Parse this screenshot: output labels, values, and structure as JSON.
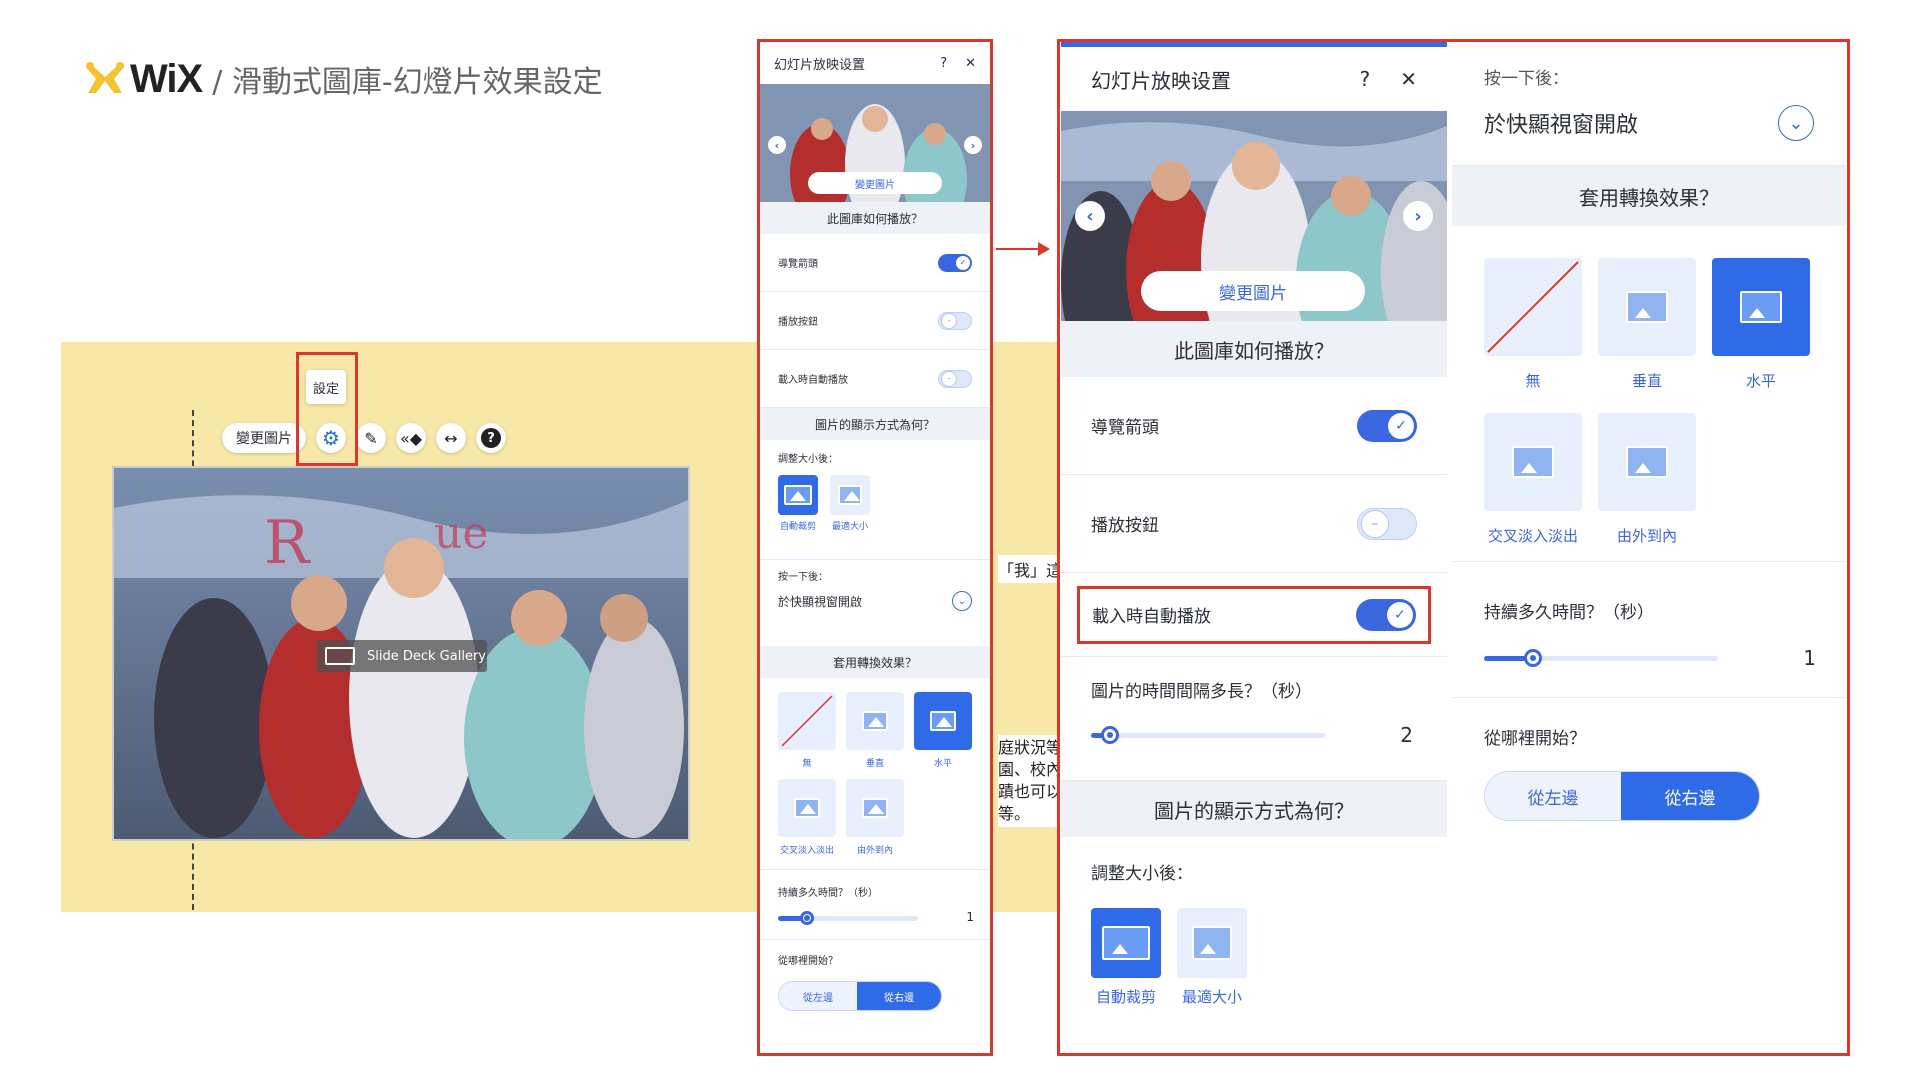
{
  "header": {
    "logo_text": "WiX",
    "title": "/ 滑動式圖庫-幻燈片效果設定"
  },
  "canvas": {
    "toolbar": {
      "change_pic": "變更圖片",
      "settings_tooltip": "設定"
    },
    "gallery_label": "Slide Deck Gallery",
    "cut_text": [
      "「我」這",
      "庭狀況等",
      "園、校內",
      "蹟也可以",
      "等。"
    ]
  },
  "panel": {
    "title": "幻灯片放映设置",
    "help": "?",
    "close": "✕",
    "change_pic_button": "變更圖片",
    "playback_section": "此圖庫如何播放？",
    "toggles": [
      {
        "label": "導覽箭頭",
        "on": true
      },
      {
        "label": "播放按鈕",
        "on": false
      },
      {
        "label": "載入時自動播放",
        "on": false
      }
    ],
    "display_section": "圖片的顯示方式為何？",
    "resize_label": "調整大小後：",
    "resize_options": [
      {
        "label": "自動裁剪",
        "selected": true
      },
      {
        "label": "最適大小",
        "selected": false
      }
    ],
    "click_label": "按一下後：",
    "click_value": "於快顯視窗開啟",
    "transition_section": "套用轉換效果？",
    "transitions": [
      {
        "label": "無",
        "selected": false
      },
      {
        "label": "垂直",
        "selected": false
      },
      {
        "label": "水平",
        "selected": true
      },
      {
        "label": "交叉淡入淡出",
        "selected": false
      },
      {
        "label": "由外到內",
        "selected": false
      }
    ],
    "duration_label": "持續多久時間？（秒）",
    "duration_value": "1",
    "start_label": "從哪裡開始？",
    "start_options": [
      {
        "label": "從左邊",
        "selected": false
      },
      {
        "label": "從右邊",
        "selected": true
      }
    ]
  },
  "zoom_panel": {
    "toggles": [
      {
        "label": "導覽箭頭",
        "on": true
      },
      {
        "label": "播放按鈕",
        "on": false
      },
      {
        "label": "載入時自動播放",
        "on": true
      }
    ],
    "interval_label": "圖片的時間間隔多長？（秒）",
    "interval_value": "2"
  },
  "colors": {
    "accent": "#3a66e0",
    "highlight": "#d9392c",
    "canvas_bg": "#f8e8a8"
  }
}
